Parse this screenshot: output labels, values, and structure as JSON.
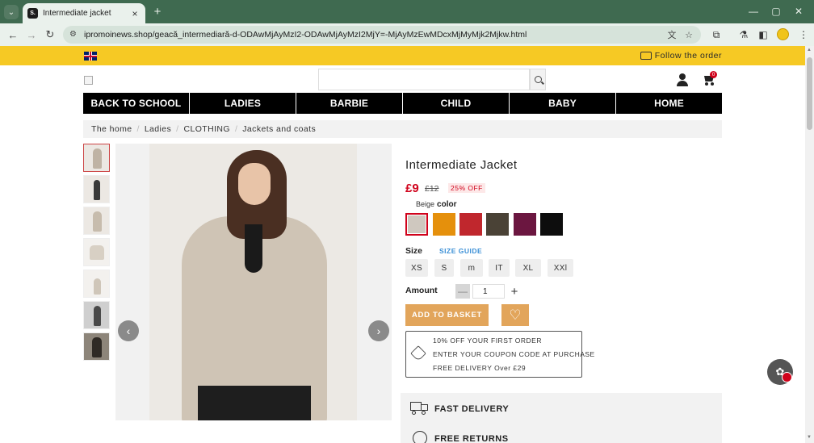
{
  "browser": {
    "tab_title": "Intermediate jacket",
    "tab_favicon_text": "S.",
    "url": "ipromoinews.shop/geacă_intermediară-d-ODAwMjAyMzI2-ODAwMjAyMzI2MjY=-MjAyMzEwMDcxMjMyMjk2Mjkw.html"
  },
  "topbar": {
    "follow_order": "Follow the order"
  },
  "cart": {
    "count": "0"
  },
  "nav": {
    "items": [
      "BACK TO SCHOOL",
      "LADIES",
      "BARBIE",
      "CHILD",
      "BABY",
      "HOME"
    ]
  },
  "breadcrumb": [
    "The home",
    "Ladies",
    "CLOTHING",
    "Jackets and coats"
  ],
  "product": {
    "title": "Intermediate Jacket",
    "price_now": "£9",
    "price_old": "£12",
    "discount": "25% OFF",
    "selected_color": "Beige",
    "color_label": "color",
    "colors": [
      {
        "name": "beige",
        "hex": "#cfc8bf"
      },
      {
        "name": "orange",
        "hex": "#e5900c"
      },
      {
        "name": "red",
        "hex": "#c0272d"
      },
      {
        "name": "olive",
        "hex": "#4a4236"
      },
      {
        "name": "plum",
        "hex": "#6b1640"
      },
      {
        "name": "black",
        "hex": "#0d0d0d"
      }
    ],
    "size_label": "Size",
    "size_guide": "SIZE GUIDE",
    "sizes": [
      "XS",
      "S",
      "m",
      "IT",
      "XL",
      "XXl"
    ],
    "amount_label": "Amount",
    "qty": "1",
    "add_to_basket": "ADD TO BASKET"
  },
  "promo": {
    "line1": "10% OFF YOUR FIRST ORDER",
    "line2": "ENTER YOUR COUPON CODE AT PURCHASE",
    "line3": "FREE DELIVERY Over £29"
  },
  "features": {
    "fast_delivery": "FAST DELIVERY",
    "free_returns": "FREE RETURNS"
  },
  "accent": {
    "yellow": "#f6c924",
    "orange_button": "#e2a55b",
    "sale_red": "#d0021b"
  }
}
